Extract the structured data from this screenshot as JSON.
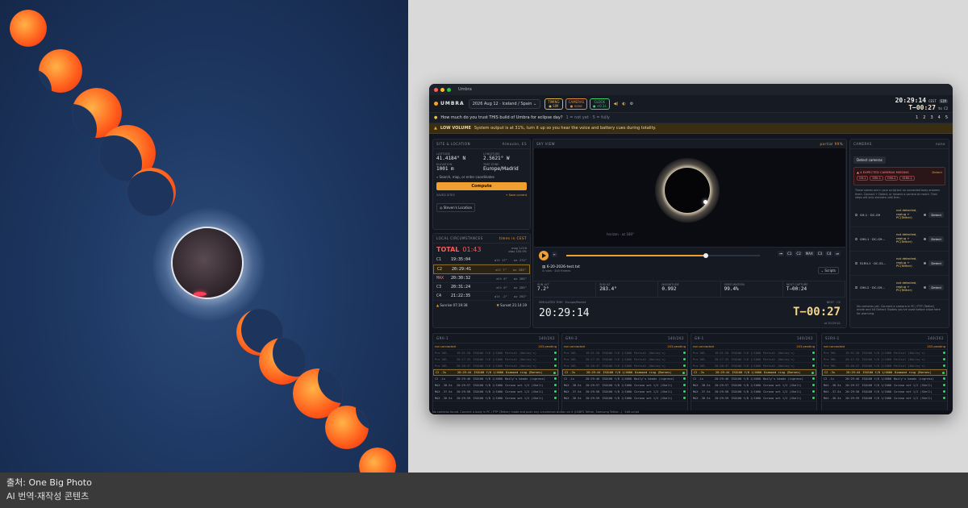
{
  "caption": {
    "source": "출처: One Big Photo",
    "note": "AI 번역·재작성 콘텐츠"
  },
  "photo": {
    "phases": [
      {
        "kind": "partial-sun"
      },
      {
        "kind": "partial-sun"
      },
      {
        "kind": "partial-sun"
      },
      {
        "kind": "partial-sun"
      },
      {
        "kind": "partial-sun"
      },
      {
        "kind": "totality"
      },
      {
        "kind": "partial-sun"
      },
      {
        "kind": "partial-sun"
      },
      {
        "kind": "partial-sun"
      },
      {
        "kind": "partial-sun"
      },
      {
        "kind": "partial-sun"
      }
    ]
  },
  "app": {
    "window_title": "Umbra",
    "brand": "UMBRA",
    "event_select": "2026 Aug 12 · Iceland / Spain",
    "chips": [
      {
        "top": "TIMING",
        "bottom": "● SIM",
        "color": "#e0b040"
      },
      {
        "top": "CAMERAS",
        "bottom": "● none",
        "color": "#e08a40"
      },
      {
        "top": "CLOCK",
        "bottom": "● +0.1s",
        "color": "#3ecf6e"
      }
    ],
    "clock": {
      "time": "20:29:14",
      "tz": "CEST",
      "badge": "SIM",
      "countdown": "T−00:27",
      "to": "to C2"
    },
    "banner_trust": {
      "text": "How much do you trust THIS build of Umbra for eclipse day?",
      "hint": "1 = not yet · 5 = fully",
      "options": [
        "1",
        "2",
        "3",
        "4",
        "5"
      ]
    },
    "banner_volume": {
      "tag": "LOW VOLUME",
      "text": "System output is at 31%, turn it up so you hear the voice and battery cues during totality."
    },
    "site": {
      "header": "SITE & LOCATION",
      "place": "Almazán, ES",
      "lat_label": "LATITUDE",
      "lat": "41.4184° N",
      "lon_label": "LONGITUDE",
      "lon": "2.5621° W",
      "elev_label": "ELEVATION",
      "elev": "1001 m",
      "tz_label": "TIME ZONE",
      "tz": "Europe/Madrid",
      "search": "Search, map, or enter coordinates",
      "compute": "Compute",
      "saved_label": "SAVED SITES",
      "save_current": "+ Save current",
      "saved_site": "Steven's Location"
    },
    "circumstances": {
      "header": "LOCAL CIRCUMSTANCES",
      "times_in": "times in CEST",
      "total_label": "TOTAL",
      "total": "01:43",
      "mag": "mag 1.016",
      "obsc": "obsc 100.0%",
      "contacts": [
        {
          "id": "C1",
          "time": "19:35:04",
          "alt": "alt 17°",
          "az": "az 274°"
        },
        {
          "id": "C2",
          "time": "20:29:41",
          "alt": "alt 7°",
          "az": "az 285°"
        },
        {
          "id": "MAX",
          "time": "20:30:32",
          "alt": "alt 6°",
          "az": "az 285°"
        },
        {
          "id": "C3",
          "time": "20:31:24",
          "alt": "alt 6°",
          "az": "az 285°"
        },
        {
          "id": "C4",
          "time": "21:22:35",
          "alt": "alt -2°",
          "az": "az 292°"
        }
      ],
      "sunrise": "Sunrise 07:19:38",
      "sunset": "Sunset 21:14:19"
    },
    "sky": {
      "header": "SKY VIEW",
      "partial": "partial 99%",
      "horizon": "horizon · az 180°"
    },
    "transport": {
      "file": "6-20-2026-test.txt",
      "meta": "4 rules · 440 frames",
      "scripts": "Scripts",
      "contacts": [
        "C1",
        "C2",
        "MAX",
        "C3",
        "C4"
      ],
      "progress": 0.72
    },
    "stats": [
      {
        "label": "SUN ALT",
        "value": "7.2°"
      },
      {
        "label": "SUN AZ",
        "value": "283.4°"
      },
      {
        "label": "MAGNITUDE",
        "value": "0.992"
      },
      {
        "label": "OBSCURATION",
        "value": "99.4%"
      },
      {
        "label": "NEXT CAPTURE",
        "value": "T−00:24"
      }
    ],
    "sim": {
      "label": "SIMULATED TIME · Europe/Madrid",
      "time": "20:29:14",
      "next_label": "NEXT · C2",
      "next": "T−00:27",
      "at": "at 20:29:41"
    },
    "cameras": {
      "header": "CAMERAS",
      "none": "none",
      "detect_btn": "Detect cameras",
      "warn_title": "4 EXPECTED CAMERAS MISSING",
      "warn_detect": "Detect",
      "missing": [
        "G9-1",
        "G9II-1",
        "G9II-2",
        "S1RII-1"
      ],
      "warn_body": "These names are in your script but no connected body answers them. Connect + Detect, or rename a camera to match. Then steps will only simulate until then.",
      "list": [
        {
          "name": "G9-1 · DC-G9",
          "status": "not detected, replug + PC(Tether)",
          "action": "Detect"
        },
        {
          "name": "G9II-1 · DC-G9...",
          "status": "not detected, replug + PC(Tether)",
          "action": "Detect"
        },
        {
          "name": "S1RII-1 · DC-S1...",
          "status": "not detected, replug + PC(Tether)",
          "action": "Detect"
        },
        {
          "name": "G9II-2 · DC-G9...",
          "status": "not detected, replug + PC(Tether)",
          "action": "Detect"
        }
      ],
      "empty": "No cameras yet. Connect a camera in PC / PTP (Tether) mode and hit Detect. Bodies you've used before show here for planning."
    },
    "grids": [
      {
        "name": "G9II-1",
        "count": "140/202",
        "status": "not connected",
        "pending": "203 pending",
        "rows": [
          {
            "a": "Pre 90%",
            "b": "19:51:20",
            "c": "ISO100 f/8 1/1000",
            "d": "Partial (Bailey's)",
            "cls": "dim"
          },
          {
            "a": "Pre 98%",
            "b": "20:17:33",
            "c": "ISO100 f/8 1/1000",
            "d": "Partial (Bailey's)",
            "cls": "dim"
          },
          {
            "a": "Pre 98%",
            "b": "20:28:47",
            "c": "ISO100 f/8 1/1000",
            "d": "Partial (Bailey's)",
            "cls": "dim"
          },
          {
            "a": "C2 -3s",
            "b": "20:29:44",
            "c": "ISO100 f/8 1/4000",
            "d": "Diamond ring (Barnes)",
            "cls": "hl"
          },
          {
            "a": "C2 -1s",
            "b": "20:29:46",
            "c": "ISO100 f/8 1/4000",
            "d": "Baily's beads (ingress)",
            "cls": ""
          },
          {
            "a": "MAX -38.5s",
            "b": "20:29:57",
            "c": "ISO100 f/8 1/1000",
            "d": "Corona set 1/2 (Shell)",
            "cls": ""
          },
          {
            "a": "MAX -37.5s",
            "b": "20:29:58",
            "c": "ISO100 f/8 1/1000",
            "d": "Corona set 1/2 (Shell)",
            "cls": ""
          },
          {
            "a": "MAX -36.5s",
            "b": "20:29:59",
            "c": "ISO100 f/8 1/1000",
            "d": "Corona set 1/2 (Shell)",
            "cls": ""
          }
        ]
      },
      {
        "name": "G9II-2",
        "count": "140/202",
        "status": "not connected",
        "pending": "203 pending",
        "rows": [
          {
            "a": "Pre 90%",
            "b": "19:51:20",
            "c": "ISO100 f/8 1/1000",
            "d": "Partial (Bailey's)",
            "cls": "dim"
          },
          {
            "a": "Pre 98%",
            "b": "20:17:33",
            "c": "ISO100 f/8 1/1000",
            "d": "Partial (Bailey's)",
            "cls": "dim"
          },
          {
            "a": "Pre 98%",
            "b": "20:28:47",
            "c": "ISO100 f/8 1/1000",
            "d": "Partial (Bailey's)",
            "cls": "dim"
          },
          {
            "a": "C2 -3s",
            "b": "20:29:44",
            "c": "ISO100 f/8 1/4000",
            "d": "Diamond ring (Barnes)",
            "cls": "hl"
          },
          {
            "a": "C2 -1s",
            "b": "20:29:46",
            "c": "ISO100 f/8 1/4000",
            "d": "Baily's beads (ingress)",
            "cls": ""
          },
          {
            "a": "MAX -38.5s",
            "b": "20:29:57",
            "c": "ISO100 f/8 1/1000",
            "d": "Corona set 1/2 (Shell)",
            "cls": ""
          },
          {
            "a": "MAX -37.5s",
            "b": "20:29:58",
            "c": "ISO100 f/8 1/1000",
            "d": "Corona set 1/2 (Shell)",
            "cls": ""
          },
          {
            "a": "MAX -36.5s",
            "b": "20:29:59",
            "c": "ISO100 f/8 1/1000",
            "d": "Corona set 1/2 (Shell)",
            "cls": ""
          }
        ]
      },
      {
        "name": "G9-1",
        "count": "140/202",
        "status": "not connected",
        "pending": "203 pending",
        "rows": [
          {
            "a": "Pre 90%",
            "b": "19:51:20",
            "c": "ISO100 f/8 1/1000",
            "d": "Partial (Bailey's)",
            "cls": "dim"
          },
          {
            "a": "Pre 98%",
            "b": "20:17:33",
            "c": "ISO100 f/8 1/1000",
            "d": "Partial (Bailey's)",
            "cls": "dim"
          },
          {
            "a": "Pre 98%",
            "b": "20:28:47",
            "c": "ISO100 f/8 1/1000",
            "d": "Partial (Bailey's)",
            "cls": "dim"
          },
          {
            "a": "C2 -3s",
            "b": "20:29:44",
            "c": "ISO100 f/8 1/4000",
            "d": "Diamond ring (Barnes)",
            "cls": "hl"
          },
          {
            "a": "C2 -1s",
            "b": "20:29:46",
            "c": "ISO100 f/8 1/4000",
            "d": "Baily's beads (ingress)",
            "cls": ""
          },
          {
            "a": "MAX -38.5s",
            "b": "20:29:57",
            "c": "ISO100 f/8 1/1000",
            "d": "Corona set 1/2 (Shell)",
            "cls": ""
          },
          {
            "a": "MAX -37.5s",
            "b": "20:29:58",
            "c": "ISO100 f/8 1/1000",
            "d": "Corona set 1/2 (Shell)",
            "cls": ""
          },
          {
            "a": "MAX -36.5s",
            "b": "20:29:59",
            "c": "ISO100 f/8 1/1000",
            "d": "Corona set 1/2 (Shell)",
            "cls": ""
          }
        ]
      },
      {
        "name": "S1RII-1",
        "count": "140/202",
        "status": "not connected",
        "pending": "203 pending",
        "rows": [
          {
            "a": "Pre 90%",
            "b": "19:51:20",
            "c": "ISO100 f/8 1/1000",
            "d": "Partial (Bailey's)",
            "cls": "dim"
          },
          {
            "a": "Pre 98%",
            "b": "20:17:33",
            "c": "ISO100 f/8 1/1000",
            "d": "Partial (Bailey's)",
            "cls": "dim"
          },
          {
            "a": "Pre 98%",
            "b": "20:28:47",
            "c": "ISO100 f/8 1/1000",
            "d": "Partial (Bailey's)",
            "cls": "dim"
          },
          {
            "a": "C2 -3s",
            "b": "20:29:44",
            "c": "ISO100 f/8 1/4000",
            "d": "Diamond ring (Barnes)",
            "cls": "hl"
          },
          {
            "a": "C2 -1s",
            "b": "20:29:46",
            "c": "ISO100 f/8 1/4000",
            "d": "Baily's beads (ingress)",
            "cls": ""
          },
          {
            "a": "MAX -38.5s",
            "b": "20:29:57",
            "c": "ISO100 f/8 1/1000",
            "d": "Corona set 1/2 (Shell)",
            "cls": ""
          },
          {
            "a": "MAX -37.5s",
            "b": "20:29:58",
            "c": "ISO100 f/8 1/1000",
            "d": "Corona set 1/2 (Shell)",
            "cls": ""
          },
          {
            "a": "MAX -36.5s",
            "b": "20:29:59",
            "c": "ISO100 f/8 1/1000",
            "d": "Corona set 1/2 (Shell)",
            "cls": ""
          }
        ]
      }
    ],
    "footer": "No cameras found. Connect a body in PC / PTP (Tether) mode and push any uncommon button on it (USBFS Tether, Samsung Tether...)  ·  Edit script"
  }
}
